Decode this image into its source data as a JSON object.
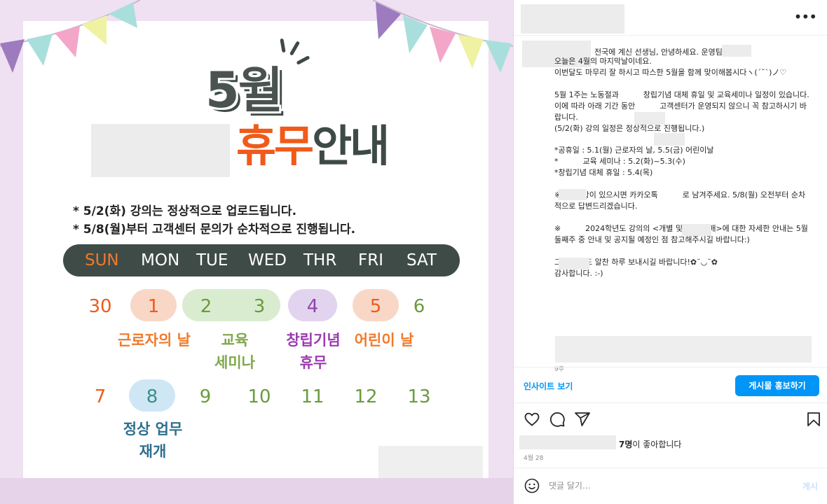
{
  "colors": {
    "brand_orange": "#f05a1a",
    "brand_dark": "#3e4a46",
    "poster_bg": "#efe0f2",
    "link_blue": "#0095f6"
  },
  "poster": {
    "month": "5월",
    "closure_word_1": "휴무",
    "closure_word_2": "안내",
    "notices": [
      "*  5/2(화) 강의는 정상적으로 업로드됩니다.",
      "*  5/8(월)부터 고객센터 문의가 순차적으로 진행됩니다."
    ],
    "weekdays": [
      "SUN",
      "MON",
      "TUE",
      "WED",
      "THR",
      "FRI",
      "SAT"
    ],
    "week1_days": [
      "30",
      "1",
      "2",
      "3",
      "4",
      "5",
      "6"
    ],
    "week2_days": [
      "7",
      "8",
      "9",
      "10",
      "11",
      "12",
      "13"
    ],
    "events": {
      "labor_day": "근로자의 날",
      "seminar": "교육\n세미나",
      "founding": "창립기념\n휴무",
      "childrens_day": "어린이 날",
      "resume": "정상 업무\n재개"
    }
  },
  "post": {
    "caption_first": "전국에 계신 선생님, 안녕하세요.          운영팀입니다.",
    "caption_body": "\n오늘은 4월의 마지막날이네요.\n이번달도 마무리 잘 하시고 따스한 5월을 함께 맞이해봅시다ヽ(´˘`)ノ♡\n\n5월 1주는 노동절과          창립기념 대체 휴일 및 교육세미나 일정이 있습니다.\n이에 따라 아래 기간 동안          고객센터가 운영되지 않으니 꼭 참고하시기 바랍니다.\n(5/2(화) 강의 일정은 정상적으로 진행됩니다.)\n\n*공휴일 : 5.1(월) 근로자의 날, 5.5(금) 어린이날\n*          교육 세미나 : 5.2(화)~5.3(수)\n*창립기념 대체 휴일 : 5.4(목)\n\n※문의사항이 있으시면 카카오톡          로 남겨주세요. 5/8(월) 오전부터 순차적으로 답변드리겠습니다.\n\n※          2024학년도 강의의 <개별 및 단과 판매>에 대한 자세한 안내는 5월 둘째주 중 안내 및 공지될 예정인 점 참고해주시길 바랍니다:)\n\n그럼 오늘도 알찬 하루 보내시길 바랍니다!✿˘◡˘✿\n감사합니다. :-)",
    "time_ago": "9주",
    "insights_label": "인사이트 보기",
    "boost_label": "게시물 홍보하기",
    "likes_count": "7명",
    "likes_suffix": "이 좋아합니다",
    "date": "4월 28",
    "comment_placeholder": "댓글 달기...",
    "post_label": "게시"
  }
}
